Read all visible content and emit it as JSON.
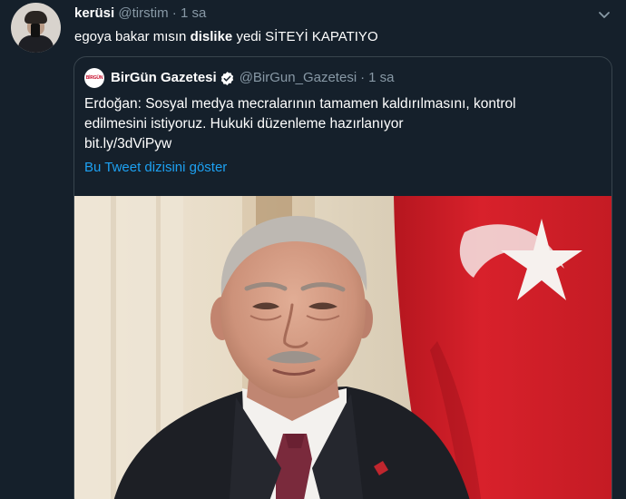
{
  "tweet": {
    "author_name": "kerüsi",
    "author_handle": "@tirstim",
    "separator": "·",
    "time": "1 sa",
    "text_before": "egoya bakar mısın ",
    "text_bold": "dislike",
    "text_after": " yedi SİTEYİ KAPATIYO"
  },
  "quoted": {
    "logo_text": "BİRGÜN",
    "author_name": "BirGün Gazetesi",
    "author_handle": "@BirGun_Gazetesi",
    "separator": "·",
    "time": "1 sa",
    "text_line1": "Erdoğan: Sosyal medya mecralarının tamamen kaldırılmasını, kontrol",
    "text_line2": "edilmesini istiyoruz. Hukuki düzenleme hazırlanıyor",
    "link": "bit.ly/3dViPyw",
    "show_thread": "Bu Tweet dizisini göster"
  },
  "colors": {
    "background": "#15202b",
    "border": "#38444d",
    "secondary_text": "#8899a6",
    "link": "#1da1f2",
    "flag_red": "#d8212b"
  },
  "icons": [
    "avatar",
    "chevron-down-icon",
    "verified-badge-icon",
    "newspaper-logo"
  ]
}
